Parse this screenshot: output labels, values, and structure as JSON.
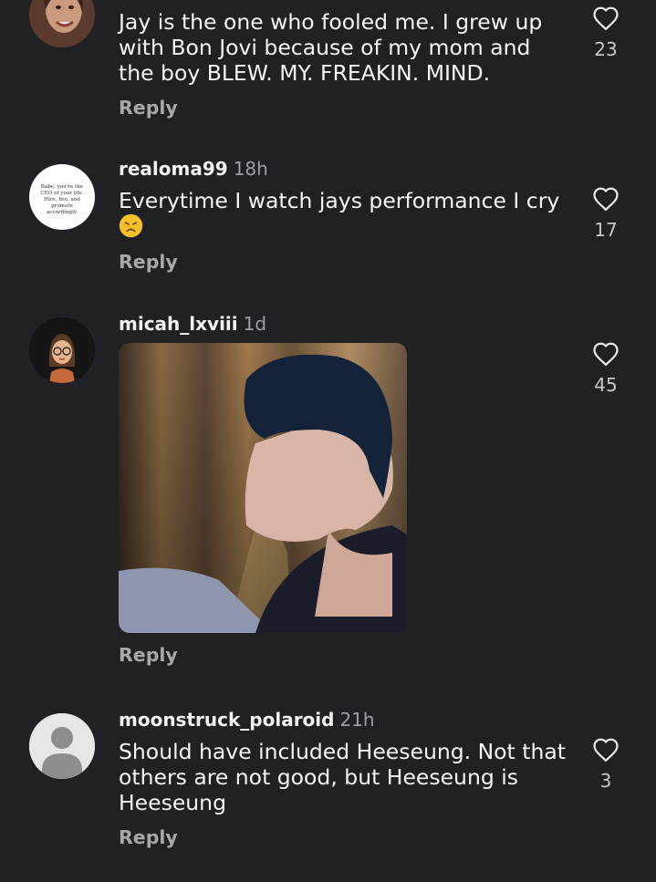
{
  "comments": [
    {
      "username": "",
      "time": "",
      "text": "Jay is the one who fooled me. I grew up with Bon Jovi because of my mom and the boy BLEW. MY. FREAKIN. MIND.",
      "reply_label": "Reply",
      "likes": "23",
      "avatar": "woman-photo-avatar"
    },
    {
      "username": "realoma99",
      "time": "18h",
      "text": "Everytime I watch jays performance I cry",
      "emoji": "disappointed-face-emoji",
      "reply_label": "Reply",
      "likes": "17",
      "avatar": "quote-card-avatar",
      "avatar_text": "Babe, you're the CEO of your life. Hire, fire, and promote accordingly."
    },
    {
      "username": "micah_lxviii",
      "time": "1d",
      "text": "",
      "media": "gif-of-man-turning-head",
      "reply_label": "Reply",
      "likes": "45",
      "avatar": "memoji-glasses-avatar"
    },
    {
      "username": "moonstruck_polaroid",
      "time": "21h",
      "text": "Should have included Heeseung. Not that others are not good, but Heeseung is Heeseung",
      "reply_label": "Reply",
      "likes": "3",
      "avatar": "default-user-avatar"
    }
  ],
  "colors": {
    "background": "#202124",
    "text": "#f5f5f5",
    "secondary": "#9aa0a6",
    "reply": "#a8a8a8"
  }
}
